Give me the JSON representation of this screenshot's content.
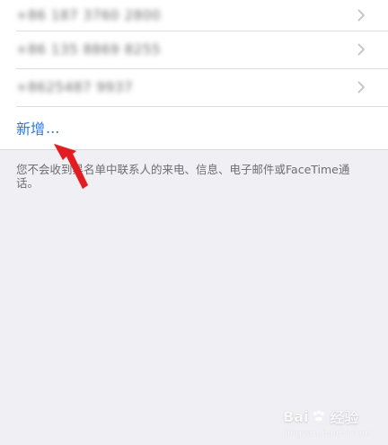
{
  "contacts": [
    {
      "number": "+86 187 3760 2800"
    },
    {
      "number": "+86 135 8869 8255"
    },
    {
      "number": "+8625487 9937"
    }
  ],
  "add_label": "新增",
  "add_ellipsis": "...",
  "footer_text": "您不会收到黑名单中联系人的来电、信息、电子邮件或FaceTime通话。",
  "watermark": {
    "brand": "Bai",
    "brand_cn": "经验",
    "url": "jingyan.baidu.com"
  },
  "colors": {
    "background": "#efeff4",
    "accent": "#2b79e3",
    "arrow": "#e31b23"
  }
}
